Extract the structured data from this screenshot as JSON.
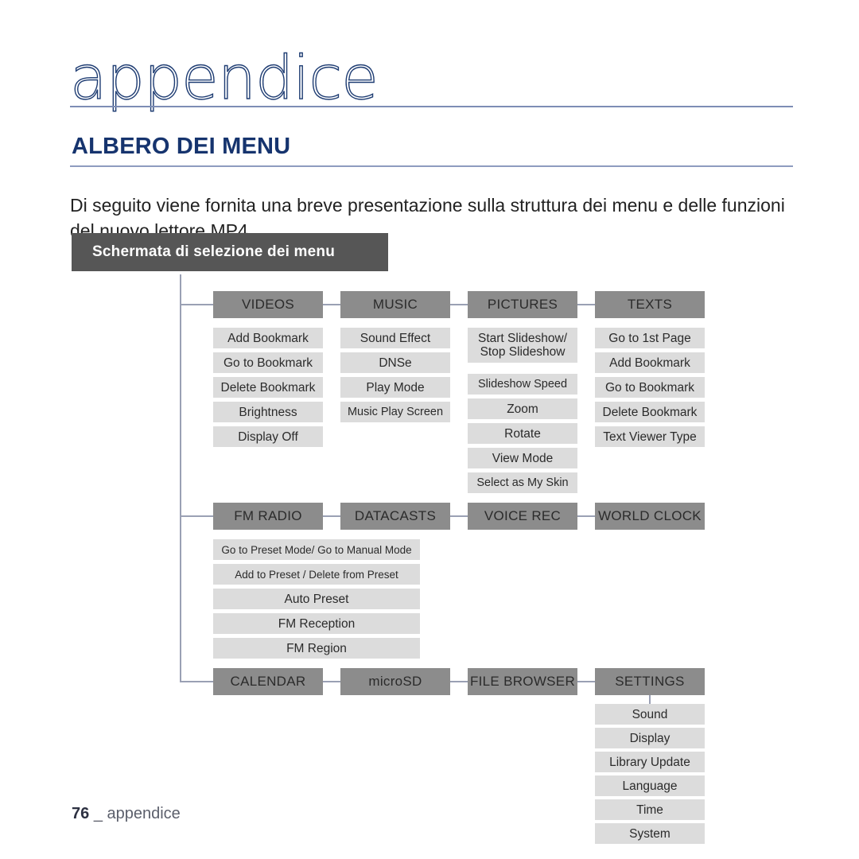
{
  "page": {
    "title": "appendice",
    "section_title": "ALBERO DEI MENU",
    "intro": "Di seguito viene fornita una breve presentazione sulla struttura dei menu e delle funzioni del nuovo lettore MP4.",
    "footer_number": "76",
    "footer_separator": "_",
    "footer_label": "appendice"
  },
  "colors": {
    "title_ink": "#1f3d73",
    "section_ink": "#16346e",
    "rule": "#8e9cbf",
    "banner_bg": "#565656",
    "node_bg": "#8c8c8c",
    "leaf_bg": "#dcdcdc",
    "connector": "#9aa0b4"
  },
  "banner": {
    "label": "Schermata di selezione dei menu"
  },
  "tree": {
    "rows": [
      {
        "row_id": "row-1",
        "columns": [
          {
            "node": "VIDEOS",
            "items": [
              "Add Bookmark",
              "Go to Bookmark",
              "Delete Bookmark",
              "Brightness",
              "Display Off"
            ]
          },
          {
            "node": "MUSIC",
            "items": [
              "Sound Effect",
              "DNSe",
              "Play Mode",
              "Music Play Screen"
            ]
          },
          {
            "node": "PICTURES",
            "items": [
              "Start Slideshow/",
              "Stop Slideshow",
              "Slideshow Speed",
              "Zoom",
              "Rotate",
              "View Mode",
              "Select as My Skin"
            ]
          },
          {
            "node": "TEXTS",
            "items": [
              "Go to 1st Page",
              "Add Bookmark",
              "Go to Bookmark",
              "Delete Bookmark",
              "Text Viewer Type"
            ]
          }
        ]
      },
      {
        "row_id": "row-2",
        "columns": [
          {
            "node": "FM RADIO",
            "items": [
              "Go to Preset Mode/ Go to Manual Mode",
              "Add to Preset / Delete from Preset",
              "Auto Preset",
              "FM Reception",
              "FM Region"
            ]
          },
          {
            "node": "DATACASTS",
            "items": []
          },
          {
            "node": "VOICE REC",
            "items": []
          },
          {
            "node": "WORLD CLOCK",
            "items": []
          }
        ]
      },
      {
        "row_id": "row-3",
        "columns": [
          {
            "node": "CALENDAR",
            "items": []
          },
          {
            "node": "microSD",
            "items": []
          },
          {
            "node": "FILE BROWSER",
            "items": []
          },
          {
            "node": "SETTINGS",
            "items": [
              "Sound",
              "Display",
              "Library Update",
              "Language",
              "Time",
              "System"
            ]
          }
        ]
      }
    ]
  }
}
